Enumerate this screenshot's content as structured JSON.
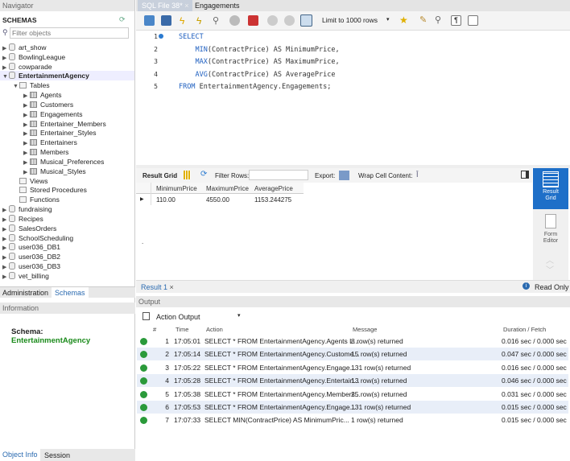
{
  "navigator": {
    "title": "Navigator",
    "schemas_label": "SCHEMAS",
    "filter_placeholder": "Filter objects",
    "tree": [
      {
        "label": "art_show",
        "type": "db",
        "level": 0,
        "expanded": false
      },
      {
        "label": "BowlingLeague",
        "type": "db",
        "level": 0,
        "expanded": false
      },
      {
        "label": "cowparade",
        "type": "db",
        "level": 0,
        "expanded": false
      },
      {
        "label": "EntertainmentAgency",
        "type": "db",
        "level": 0,
        "expanded": true,
        "bold": true
      },
      {
        "label": "Tables",
        "type": "folder",
        "level": 1,
        "expanded": true
      },
      {
        "label": "Agents",
        "type": "table",
        "level": 2
      },
      {
        "label": "Customers",
        "type": "table",
        "level": 2
      },
      {
        "label": "Engagements",
        "type": "table",
        "level": 2
      },
      {
        "label": "Entertainer_Members",
        "type": "table",
        "level": 2
      },
      {
        "label": "Entertainer_Styles",
        "type": "table",
        "level": 2
      },
      {
        "label": "Entertainers",
        "type": "table",
        "level": 2
      },
      {
        "label": "Members",
        "type": "table",
        "level": 2
      },
      {
        "label": "Musical_Preferences",
        "type": "table",
        "level": 2
      },
      {
        "label": "Musical_Styles",
        "type": "table",
        "level": 2
      },
      {
        "label": "Views",
        "type": "folder",
        "level": 1
      },
      {
        "label": "Stored Procedures",
        "type": "folder",
        "level": 1
      },
      {
        "label": "Functions",
        "type": "folder",
        "level": 1
      },
      {
        "label": "fundraising",
        "type": "db",
        "level": 0
      },
      {
        "label": "Recipes",
        "type": "db",
        "level": 0
      },
      {
        "label": "SalesOrders",
        "type": "db",
        "level": 0
      },
      {
        "label": "SchoolScheduling",
        "type": "db",
        "level": 0
      },
      {
        "label": "user036_DB1",
        "type": "db",
        "level": 0
      },
      {
        "label": "user036_DB2",
        "type": "db",
        "level": 0
      },
      {
        "label": "user036_DB3",
        "type": "db",
        "level": 0
      },
      {
        "label": "vet_billing",
        "type": "db",
        "level": 0
      }
    ],
    "tabs": [
      "Administration",
      "Schemas"
    ],
    "info_title": "Information",
    "schema_label": "Schema:",
    "schema_value": "EntertainmentAgency",
    "bottom_tabs": [
      "Object Info",
      "Session"
    ]
  },
  "editor": {
    "tabs": [
      "SQL File 38*",
      "Engagements"
    ],
    "limit": "Limit to 1000 rows",
    "lines": [
      [
        "SELECT",
        ""
      ],
      [
        "    MIN",
        "(ContractPrice) AS MinimumPrice,"
      ],
      [
        "    MAX",
        "(ContractPrice) AS MaximumPrice,"
      ],
      [
        "    AVG",
        "(ContractPrice) AS AveragePrice"
      ],
      [
        "FROM",
        "EntertainmentAgency.Engagements;"
      ]
    ],
    "line_numbers": [
      "1",
      "2",
      "3",
      "4",
      "5"
    ]
  },
  "result": {
    "result_grid_label": "Result Grid",
    "filter_label": "Filter Rows:",
    "export_label": "Export:",
    "wrap_label": "Wrap Cell Content:",
    "columns": [
      "MinimumPrice",
      "MaximumPrice",
      "AveragePrice"
    ],
    "rows": [
      [
        "110.00",
        "4550.00",
        "1153.244275"
      ]
    ],
    "side": [
      "Result Grid",
      "Form Editor"
    ],
    "tab": "Result 1",
    "read_only": "Read Only"
  },
  "output": {
    "title": "Output",
    "selector": "Action Output",
    "columns": [
      "#",
      "Time",
      "Action",
      "Message",
      "Duration / Fetch"
    ],
    "rows": [
      [
        "1",
        "17:05:01",
        "SELECT * FROM EntertainmentAgency.Agents L...",
        "8 row(s) returned",
        "0.016 sec / 0.000 sec"
      ],
      [
        "2",
        "17:05:14",
        "SELECT * FROM EntertainmentAgency.Custome...",
        "15 row(s) returned",
        "0.047 sec / 0.000 sec"
      ],
      [
        "3",
        "17:05:22",
        "SELECT * FROM EntertainmentAgency.Engage...",
        "131 row(s) returned",
        "0.016 sec / 0.000 sec"
      ],
      [
        "4",
        "17:05:28",
        "SELECT * FROM EntertainmentAgency.Entertain...",
        "13 row(s) returned",
        "0.046 sec / 0.000 sec"
      ],
      [
        "5",
        "17:05:38",
        "SELECT * FROM EntertainmentAgency.Members...",
        "25 row(s) returned",
        "0.031 sec / 0.000 sec"
      ],
      [
        "6",
        "17:05:53",
        "SELECT * FROM EntertainmentAgency.Engage...",
        "131 row(s) returned",
        "0.015 sec / 0.000 sec"
      ],
      [
        "7",
        "17:07:33",
        "SELECT     MIN(ContractPrice) AS MinimumPric...",
        "1 row(s) returned",
        "0.015 sec / 0.000 sec"
      ]
    ]
  }
}
